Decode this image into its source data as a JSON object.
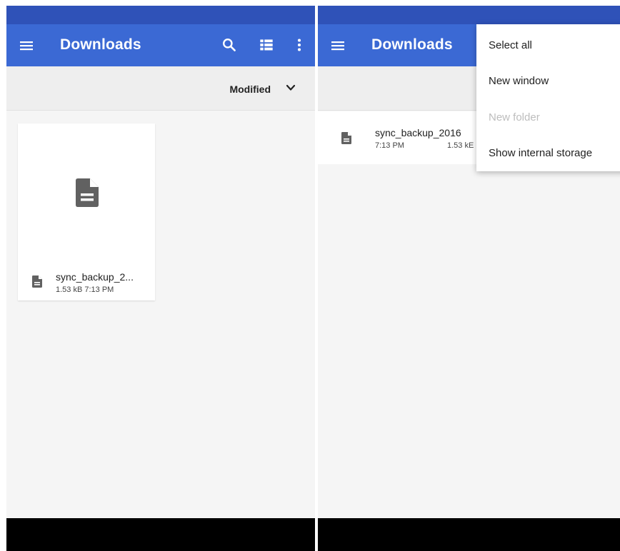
{
  "left": {
    "app_bar": {
      "title": "Downloads"
    },
    "sort": {
      "label": "Modified"
    },
    "file": {
      "name": "sync_backup_2...",
      "meta": "1.53 kB 7:13 PM"
    }
  },
  "right": {
    "app_bar": {
      "title": "Downloads"
    },
    "file": {
      "name": "sync_backup_2016",
      "date": "7:13 PM",
      "size": "1.53 kE"
    },
    "menu": {
      "items": [
        {
          "label": "Select all",
          "enabled": true
        },
        {
          "label": "New window",
          "enabled": true
        },
        {
          "label": "New folder",
          "enabled": false
        },
        {
          "label": "Show internal storage",
          "enabled": true
        }
      ]
    }
  },
  "colors": {
    "status_bar": "#2f52b8",
    "app_bar": "#3b69d4",
    "background": "#f5f5f5",
    "icon": "#616161",
    "nav_bar": "#000000"
  }
}
